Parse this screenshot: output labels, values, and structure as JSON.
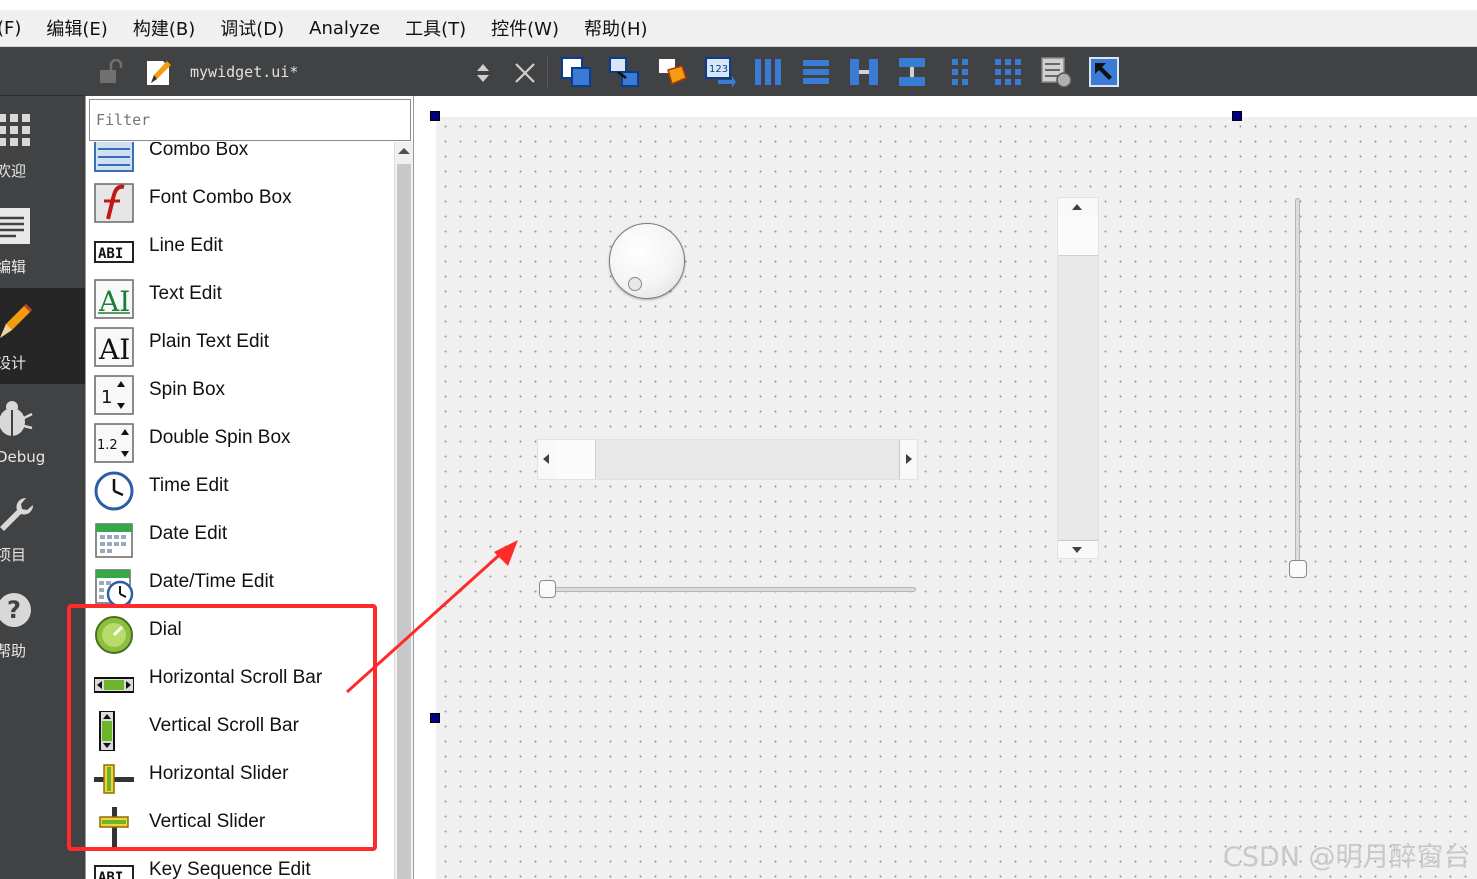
{
  "menu": [
    "(F)",
    "编辑(E)",
    "构建(B)",
    "调试(D)",
    "Analyze",
    "工具(T)",
    "控件(W)",
    "帮助(H)"
  ],
  "modes": [
    {
      "label": "欢迎",
      "icon": "grid-icon",
      "active": false
    },
    {
      "label": "编辑",
      "icon": "edit-document-icon",
      "active": false
    },
    {
      "label": "设计",
      "icon": "pencil-icon",
      "active": true
    },
    {
      "label": "Debug",
      "icon": "bug-icon",
      "active": false
    },
    {
      "label": "项目",
      "icon": "wrench-icon",
      "active": false
    },
    {
      "label": "帮助",
      "icon": "help-icon",
      "active": false
    }
  ],
  "toolbar": {
    "filename": "mywidget.ui*",
    "icons": [
      "edit-widgets-icon",
      "edit-signals-slots-icon",
      "edit-buddies-icon",
      "edit-tab-order-icon",
      "layout-horizontal-icon",
      "layout-vertical-icon",
      "layout-horizontal-splitter-icon",
      "layout-vertical-splitter-icon",
      "layout-form-icon",
      "layout-grid-icon",
      "break-layout-icon",
      "adjust-size-icon"
    ]
  },
  "widget_box": {
    "filter_placeholder": "Filter",
    "items": [
      {
        "label": "Combo Box",
        "icon": "combo-box-icon"
      },
      {
        "label": "Font Combo Box",
        "icon": "font-combo-box-icon"
      },
      {
        "label": "Line Edit",
        "icon": "line-edit-icon"
      },
      {
        "label": "Text Edit",
        "icon": "text-edit-icon"
      },
      {
        "label": "Plain Text Edit",
        "icon": "plain-text-edit-icon"
      },
      {
        "label": "Spin Box",
        "icon": "spin-box-icon"
      },
      {
        "label": "Double Spin Box",
        "icon": "double-spin-box-icon"
      },
      {
        "label": "Time Edit",
        "icon": "clock-icon"
      },
      {
        "label": "Date Edit",
        "icon": "calendar-icon"
      },
      {
        "label": "Date/Time Edit",
        "icon": "calendar-clock-icon"
      },
      {
        "label": "Dial",
        "icon": "dial-icon"
      },
      {
        "label": "Horizontal Scroll Bar",
        "icon": "horizontal-scroll-bar-icon"
      },
      {
        "label": "Vertical Scroll Bar",
        "icon": "vertical-scroll-bar-icon"
      },
      {
        "label": "Horizontal Slider",
        "icon": "horizontal-slider-icon"
      },
      {
        "label": "Vertical Slider",
        "icon": "vertical-slider-icon"
      },
      {
        "label": "Key Sequence Edit",
        "icon": "key-sequence-edit-icon"
      }
    ]
  },
  "watermark": "CSDN @明月醉窗台",
  "colors": {
    "highlight": "#ff2a2a",
    "mode_bg": "#404244",
    "active_mode_bg": "#262626",
    "selection_handle": "#000080"
  }
}
